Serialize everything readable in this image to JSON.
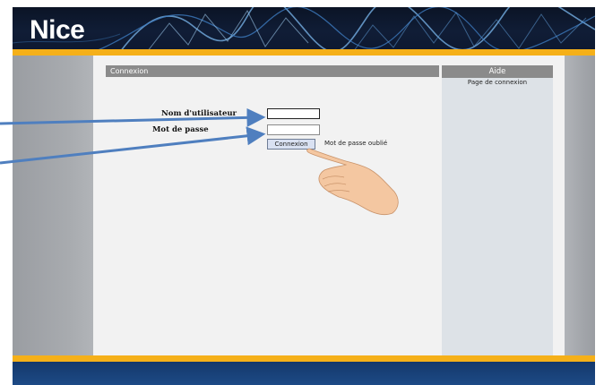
{
  "brand": {
    "logo_text": "Nice",
    "accent_color": "#f5b019",
    "header_color": "#0d1830",
    "footer_color": "#1d4a86"
  },
  "main": {
    "section_title": "Connexion",
    "form": {
      "username_label": "Nom d'utilisateur",
      "username_value": "",
      "password_label": "Mot de passe",
      "password_value": "",
      "submit_label": "Connexion",
      "forgot_link": "Mot de passe oublié"
    }
  },
  "help": {
    "title": "Aide",
    "text": "Page de connexion"
  },
  "annotations": {
    "arrow_color": "#4f7fbf",
    "pointer": "hand-pointer-icon"
  }
}
